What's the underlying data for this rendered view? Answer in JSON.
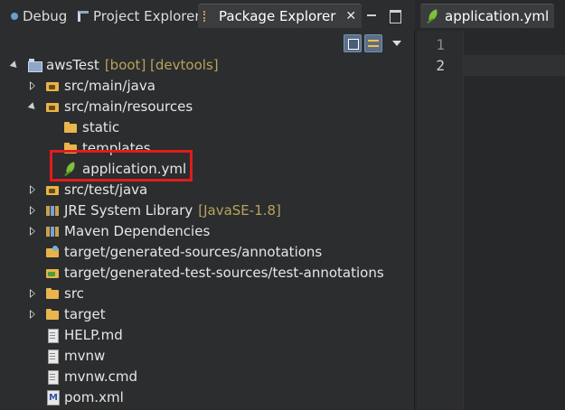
{
  "tabs": [
    {
      "label": "Debug",
      "icon": "debug-icon",
      "active": false
    },
    {
      "label": "Project Explorer",
      "icon": "project-explorer-icon",
      "active": false
    },
    {
      "label": "Package Explorer",
      "icon": "package-explorer-icon",
      "active": true,
      "close": "✕"
    }
  ],
  "tree": [
    {
      "label": "awsTest",
      "deco": "[boot] [devtools]",
      "icon": "project-icon",
      "twisty": "open",
      "level": 0
    },
    {
      "label": "src/main/java",
      "deco": "",
      "icon": "source-folder-icon",
      "twisty": "closed",
      "level": 1
    },
    {
      "label": "src/main/resources",
      "deco": "",
      "icon": "source-folder-icon",
      "twisty": "open",
      "level": 1
    },
    {
      "label": "static",
      "deco": "",
      "icon": "folder-icon",
      "twisty": "",
      "level": 2
    },
    {
      "label": "templates",
      "deco": "",
      "icon": "folder-icon",
      "twisty": "",
      "level": 2
    },
    {
      "label": "application.yml",
      "deco": "",
      "icon": "spring-leaf-icon",
      "twisty": "",
      "level": 2
    },
    {
      "label": "src/test/java",
      "deco": "",
      "icon": "source-folder-icon",
      "twisty": "closed",
      "level": 1
    },
    {
      "label": "JRE System Library",
      "deco": "[JavaSE-1.8]",
      "icon": "library-icon",
      "twisty": "closed",
      "level": 1
    },
    {
      "label": "Maven Dependencies",
      "deco": "",
      "icon": "library-icon",
      "twisty": "closed",
      "level": 1
    },
    {
      "label": "target/generated-sources/annotations",
      "deco": "",
      "icon": "generated-folder-icon",
      "twisty": "",
      "level": 1
    },
    {
      "label": "target/generated-test-sources/test-annotations",
      "deco": "",
      "icon": "generated-test-folder-icon",
      "twisty": "",
      "level": 1
    },
    {
      "label": "src",
      "deco": "",
      "icon": "folder-icon",
      "twisty": "closed",
      "level": 1
    },
    {
      "label": "target",
      "deco": "",
      "icon": "folder-icon",
      "twisty": "closed",
      "level": 1
    },
    {
      "label": "HELP.md",
      "deco": "",
      "icon": "file-icon",
      "twisty": "",
      "level": 1
    },
    {
      "label": "mvnw",
      "deco": "",
      "icon": "file-icon",
      "twisty": "",
      "level": 1
    },
    {
      "label": "mvnw.cmd",
      "deco": "",
      "icon": "file-icon",
      "twisty": "",
      "level": 1
    },
    {
      "label": "pom.xml",
      "deco": "",
      "icon": "maven-pom-icon",
      "twisty": "",
      "level": 1
    }
  ],
  "editor": {
    "tab_label": "application.yml",
    "line_numbers": [
      "1",
      "2"
    ]
  },
  "colors": {
    "highlight": "#e31b1b",
    "decoration": "#b8a35a"
  }
}
